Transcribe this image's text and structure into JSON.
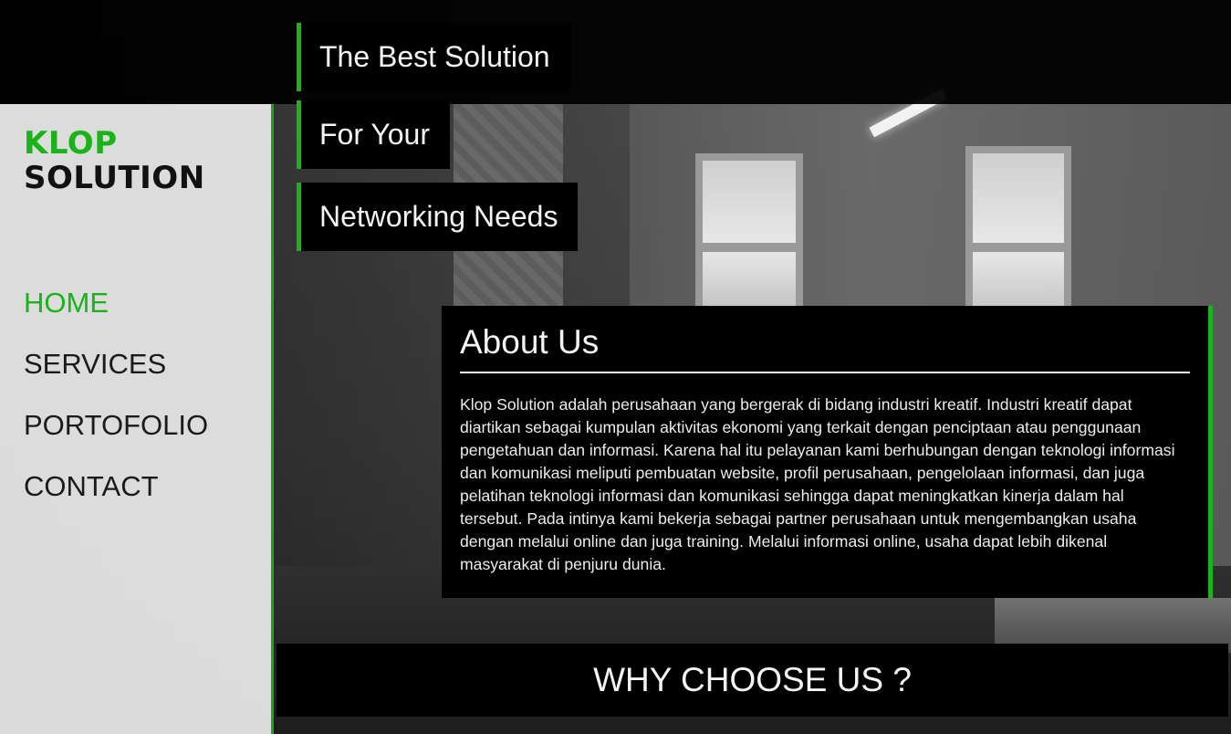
{
  "brand": {
    "line1": "KLOP",
    "line2": "SOLUTION",
    "accent_color": "#1ab31a"
  },
  "nav": {
    "items": [
      {
        "label": "HOME",
        "active": true
      },
      {
        "label": "SERVICES",
        "active": false
      },
      {
        "label": "PORTOFOLIO",
        "active": false
      },
      {
        "label": "CONTACT",
        "active": false
      }
    ]
  },
  "hero": {
    "slogan_lines": [
      "The Best Solution",
      "For Your",
      "Networking Needs"
    ]
  },
  "about": {
    "title": "About Us",
    "body": "Klop Solution adalah perusahaan yang bergerak di bidang industri kreatif. Industri kreatif dapat diartikan sebagai kumpulan aktivitas ekonomi yang terkait dengan penciptaan atau penggunaan pengetahuan dan informasi. Karena hal itu pelayanan kami berhubungan dengan teknologi informasi dan komunikasi meliputi pembuatan website, profil perusahaan, pengelolaan informasi, dan juga pelatihan teknologi informasi dan komunikasi sehingga dapat meningkatkan kinerja dalam hal tersebut. Pada intinya kami bekerja sebagai partner perusahaan untuk mengembangkan usaha dengan melalui online dan juga training. Melalui informasi online, usaha dapat lebih dikenal masyarakat di penjuru dunia."
  },
  "why": {
    "title": "WHY CHOOSE US ?"
  }
}
